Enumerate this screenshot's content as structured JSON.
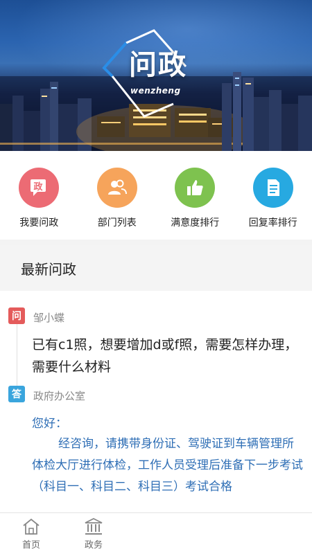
{
  "banner": {
    "logo_text": "问政",
    "logo_subtext": "wenzheng"
  },
  "quick_menu": [
    {
      "label": "我要问政",
      "icon": "ask-government-icon",
      "color": "#ec6b74"
    },
    {
      "label": "部门列表",
      "icon": "department-people-icon",
      "color": "#f6a45b"
    },
    {
      "label": "满意度排行",
      "icon": "thumbs-up-icon",
      "color": "#7ec24f"
    },
    {
      "label": "回复率排行",
      "icon": "document-icon",
      "color": "#27a9e1"
    }
  ],
  "section": {
    "title": "最新问政"
  },
  "post": {
    "question_tag": "问",
    "asker": "邹小蝶",
    "question": "已有c1照，想要增加d或f照，需要怎样办理，需要什么材料",
    "answer_tag": "答",
    "answerer": "政府办公室",
    "greeting": "您好：",
    "answer": "经咨询，请携带身份证、驾驶证到车辆管理所体检大厅进行体检，工作人员受理后准备下一步考试（科目一、科目二、科目三）考试合格"
  },
  "bottom_nav": [
    {
      "label": "首页",
      "icon": "home-icon"
    },
    {
      "label": "政务",
      "icon": "government-building-icon"
    }
  ],
  "colors": {
    "question_tag": "#e45b5b",
    "answer_tag": "#3aa5dd",
    "answer_text": "#2e6eb5"
  }
}
